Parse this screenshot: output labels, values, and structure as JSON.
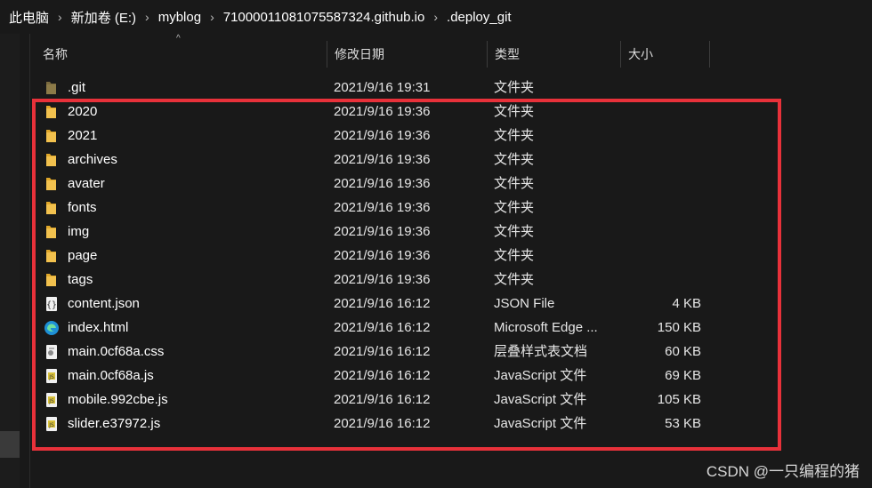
{
  "breadcrumb": {
    "items": [
      "此电脑",
      "新加卷 (E:)",
      "myblog",
      "71000011081075587324.github.io",
      ".deploy_git"
    ],
    "separator": "›"
  },
  "columns": {
    "name": "名称",
    "date": "修改日期",
    "type": "类型",
    "size": "大小",
    "sort_indicator": "^"
  },
  "files": [
    {
      "name": ".git",
      "date": "2021/9/16 19:31",
      "type": "文件夹",
      "size": "",
      "icon": "folder-hidden-icon"
    },
    {
      "name": "2020",
      "date": "2021/9/16 19:36",
      "type": "文件夹",
      "size": "",
      "icon": "folder-icon"
    },
    {
      "name": "2021",
      "date": "2021/9/16 19:36",
      "type": "文件夹",
      "size": "",
      "icon": "folder-icon"
    },
    {
      "name": "archives",
      "date": "2021/9/16 19:36",
      "type": "文件夹",
      "size": "",
      "icon": "folder-icon"
    },
    {
      "name": "avater",
      "date": "2021/9/16 19:36",
      "type": "文件夹",
      "size": "",
      "icon": "folder-icon"
    },
    {
      "name": "fonts",
      "date": "2021/9/16 19:36",
      "type": "文件夹",
      "size": "",
      "icon": "folder-icon"
    },
    {
      "name": "img",
      "date": "2021/9/16 19:36",
      "type": "文件夹",
      "size": "",
      "icon": "folder-icon"
    },
    {
      "name": "page",
      "date": "2021/9/16 19:36",
      "type": "文件夹",
      "size": "",
      "icon": "folder-icon"
    },
    {
      "name": "tags",
      "date": "2021/9/16 19:36",
      "type": "文件夹",
      "size": "",
      "icon": "folder-icon"
    },
    {
      "name": "content.json",
      "date": "2021/9/16 16:12",
      "type": "JSON File",
      "size": "4 KB",
      "icon": "json-file-icon"
    },
    {
      "name": "index.html",
      "date": "2021/9/16 16:12",
      "type": "Microsoft Edge ...",
      "size": "150 KB",
      "icon": "edge-html-icon"
    },
    {
      "name": "main.0cf68a.css",
      "date": "2021/9/16 16:12",
      "type": "层叠样式表文档",
      "size": "60 KB",
      "icon": "css-file-icon"
    },
    {
      "name": "main.0cf68a.js",
      "date": "2021/9/16 16:12",
      "type": "JavaScript 文件",
      "size": "69 KB",
      "icon": "js-file-icon"
    },
    {
      "name": "mobile.992cbe.js",
      "date": "2021/9/16 16:12",
      "type": "JavaScript 文件",
      "size": "105 KB",
      "icon": "js-file-icon"
    },
    {
      "name": "slider.e37972.js",
      "date": "2021/9/16 16:12",
      "type": "JavaScript 文件",
      "size": "53 KB",
      "icon": "js-file-icon"
    }
  ],
  "watermark": "CSDN @一只编程的猪",
  "colors": {
    "background": "#191919",
    "folder": "#f2c14e",
    "highlight_border": "#e8313a"
  }
}
